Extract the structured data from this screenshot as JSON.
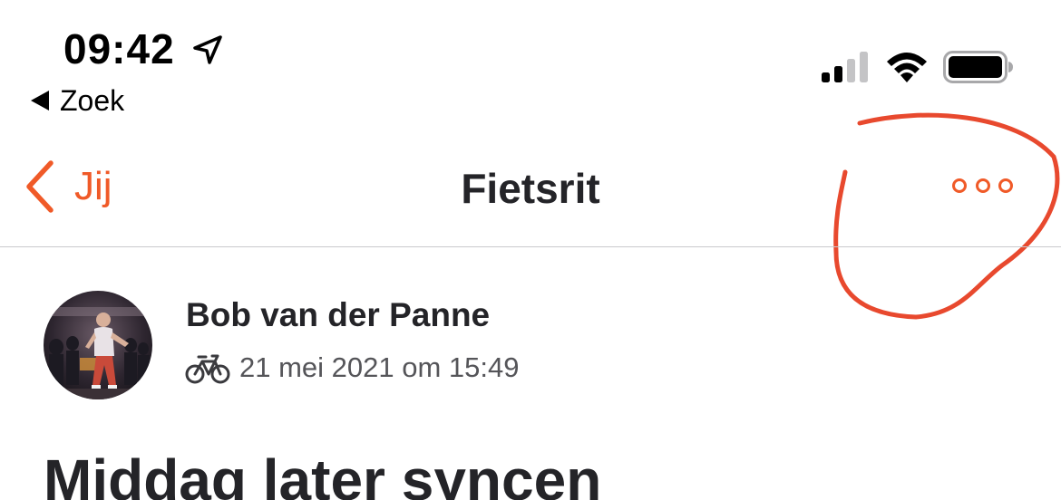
{
  "status_bar": {
    "time": "09:42",
    "back_app_label": "Zoek",
    "icons": [
      "location-arrow-icon",
      "cellular-signal-icon",
      "wifi-icon",
      "battery-icon"
    ]
  },
  "nav": {
    "back_label": "Jij",
    "title": "Fietsrit",
    "more_icon": "more-horizontal-icon",
    "accent_color": "#f05a28"
  },
  "activity": {
    "athlete_name": "Bob van der Panne",
    "sport_icon": "bike-icon",
    "datetime": "21 mei 2021 om 15:49",
    "title": "Middag later syncen"
  },
  "annotation": {
    "type": "hand-drawn circle around more button",
    "color": "#e8492e"
  }
}
